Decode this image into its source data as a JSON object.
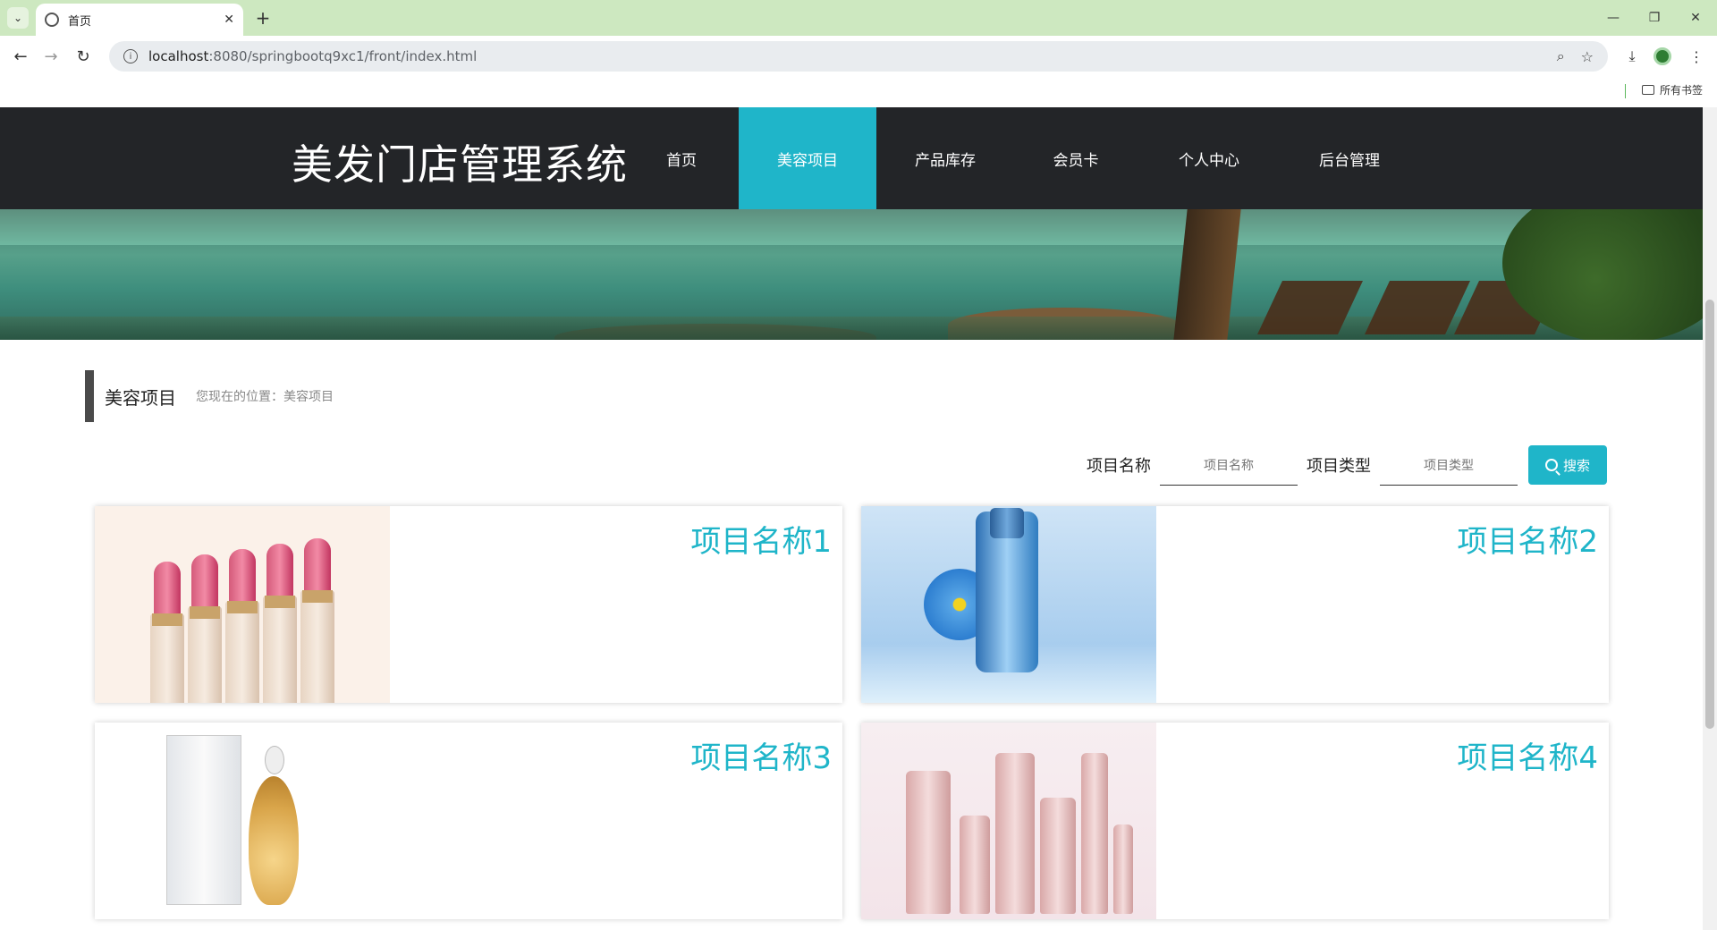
{
  "browser": {
    "tab_title": "首页",
    "url_host": "localhost",
    "url_rest": ":8080/springbootq9xc1/front/index.html",
    "bookmarks_label": "所有书签"
  },
  "header": {
    "site_title": "美发门店管理系统",
    "nav": [
      {
        "label": "首页",
        "active": false
      },
      {
        "label": "美容项目",
        "active": true
      },
      {
        "label": "产品库存",
        "active": false
      },
      {
        "label": "会员卡",
        "active": false
      },
      {
        "label": "个人中心",
        "active": false
      },
      {
        "label": "后台管理",
        "active": false
      }
    ]
  },
  "section": {
    "title": "美容项目",
    "breadcrumb": "您现在的位置：美容项目"
  },
  "filters": {
    "name_label": "项目名称",
    "name_placeholder": "项目名称",
    "type_label": "项目类型",
    "type_placeholder": "项目类型",
    "search_label": "搜索"
  },
  "cards": [
    {
      "name": "项目名称1",
      "image": "lipsticks"
    },
    {
      "name": "项目名称2",
      "image": "blue-serum-bottle"
    },
    {
      "name": "项目名称3",
      "image": "perfume"
    },
    {
      "name": "项目名称4",
      "image": "pink-cosmetics"
    }
  ],
  "colors": {
    "accent": "#1fb5c9",
    "header_bg": "#232528",
    "tabbar_bg": "#cde8c0"
  }
}
